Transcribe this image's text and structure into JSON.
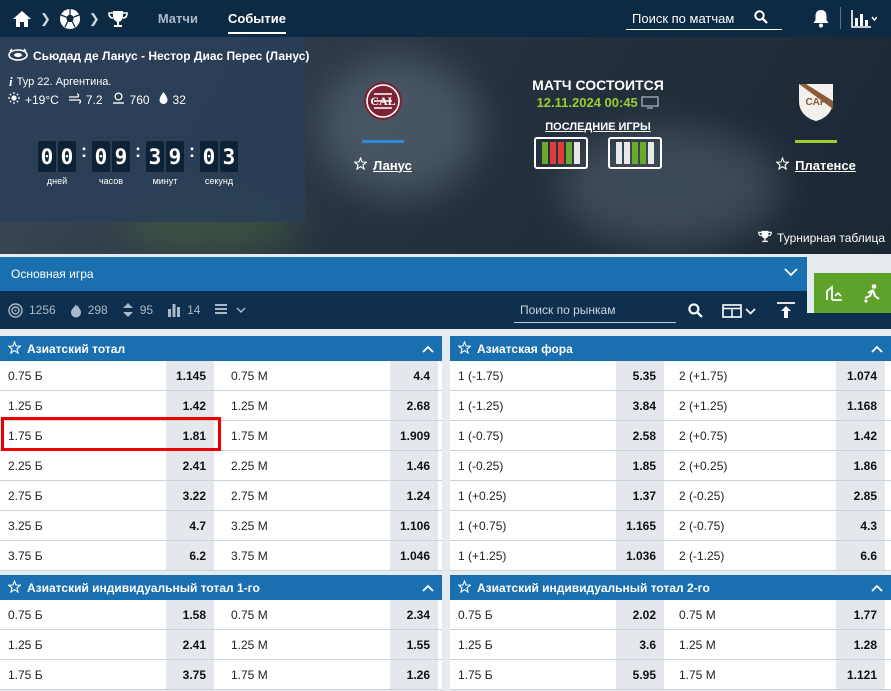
{
  "nav": {
    "tab_matches": "Матчи",
    "tab_event": "Событие",
    "search_placeholder": "Поиск по матчам"
  },
  "match": {
    "venue": "Сьюдад де Ланус - Нестор Диас Перес (Ланус)",
    "tour": "Тур 22. Аргентина.",
    "weather": {
      "temp": "+19°C",
      "wind": "7.2",
      "pressure": "760",
      "humidity": "32"
    },
    "countdown": {
      "days": [
        "0",
        "0"
      ],
      "hours": [
        "0",
        "9"
      ],
      "minutes": [
        "3",
        "9"
      ],
      "seconds": [
        "0",
        "3"
      ],
      "labels": [
        "дней",
        "часов",
        "минут",
        "секунд"
      ]
    },
    "home": {
      "name": "Ланус",
      "bar_color": "#2d8ad8",
      "logo_text": "CAL"
    },
    "away": {
      "name": "Платенсе",
      "bar_color": "#9acd32",
      "logo_text": "CAP"
    },
    "status": "МАТЧ СОСТОИТСЯ",
    "datetime": "12.11.2024 00:45",
    "last_games": "ПОСЛЕДНИЕ ИГРЫ",
    "home_form": [
      "#6aaa2a",
      "#e23b3b",
      "#e23b3b",
      "#6aaa2a",
      "#e8e8e8"
    ],
    "away_form": [
      "#e8e8e8",
      "#e8e8e8",
      "#6aaa2a",
      "#6aaa2a",
      "#e8e8e8"
    ],
    "standings": "Турнирная таблица"
  },
  "market_bar": {
    "title": "Основная игра"
  },
  "filters": {
    "all": "1256",
    "hot": "298",
    "ou": "95",
    "stats": "14",
    "search_placeholder": "Поиск по рынкам"
  },
  "sections": [
    {
      "title": "Азиатский тотал",
      "rows": [
        [
          "0.75 Б",
          "1.145",
          "0.75 М",
          "4.4"
        ],
        [
          "1.25 Б",
          "1.42",
          "1.25 М",
          "2.68"
        ],
        [
          "1.75 Б",
          "1.81",
          "1.75 М",
          "1.909"
        ],
        [
          "2.25 Б",
          "2.41",
          "2.25 М",
          "1.46"
        ],
        [
          "2.75 Б",
          "3.22",
          "2.75 М",
          "1.24"
        ],
        [
          "3.25 Б",
          "4.7",
          "3.25 М",
          "1.106"
        ],
        [
          "3.75 Б",
          "6.2",
          "3.75 М",
          "1.046"
        ]
      ]
    },
    {
      "title": "Азиатская фора",
      "rows": [
        [
          "1 (-1.75)",
          "5.35",
          "2 (+1.75)",
          "1.074"
        ],
        [
          "1 (-1.25)",
          "3.84",
          "2 (+1.25)",
          "1.168"
        ],
        [
          "1 (-0.75)",
          "2.58",
          "2 (+0.75)",
          "1.42"
        ],
        [
          "1 (-0.25)",
          "1.85",
          "2 (+0.25)",
          "1.86"
        ],
        [
          "1 (+0.25)",
          "1.37",
          "2 (-0.25)",
          "2.85"
        ],
        [
          "1 (+0.75)",
          "1.165",
          "2 (-0.75)",
          "4.3"
        ],
        [
          "1 (+1.25)",
          "1.036",
          "2 (-1.25)",
          "6.6"
        ]
      ]
    },
    {
      "title": "Азиатский индивидуальный тотал 1-го",
      "rows": [
        [
          "0.75 Б",
          "1.58",
          "0.75 М",
          "2.34"
        ],
        [
          "1.25 Б",
          "2.41",
          "1.25 М",
          "1.55"
        ],
        [
          "1.75 Б",
          "3.75",
          "1.75 М",
          "1.26"
        ]
      ]
    },
    {
      "title": "Азиатский индивидуальный тотал 2-го",
      "rows": [
        [
          "0.75 Б",
          "2.02",
          "0.75 М",
          "1.77"
        ],
        [
          "1.25 Б",
          "3.6",
          "1.25 М",
          "1.28"
        ],
        [
          "1.75 Б",
          "5.95",
          "1.75 М",
          "1.121"
        ]
      ]
    }
  ]
}
